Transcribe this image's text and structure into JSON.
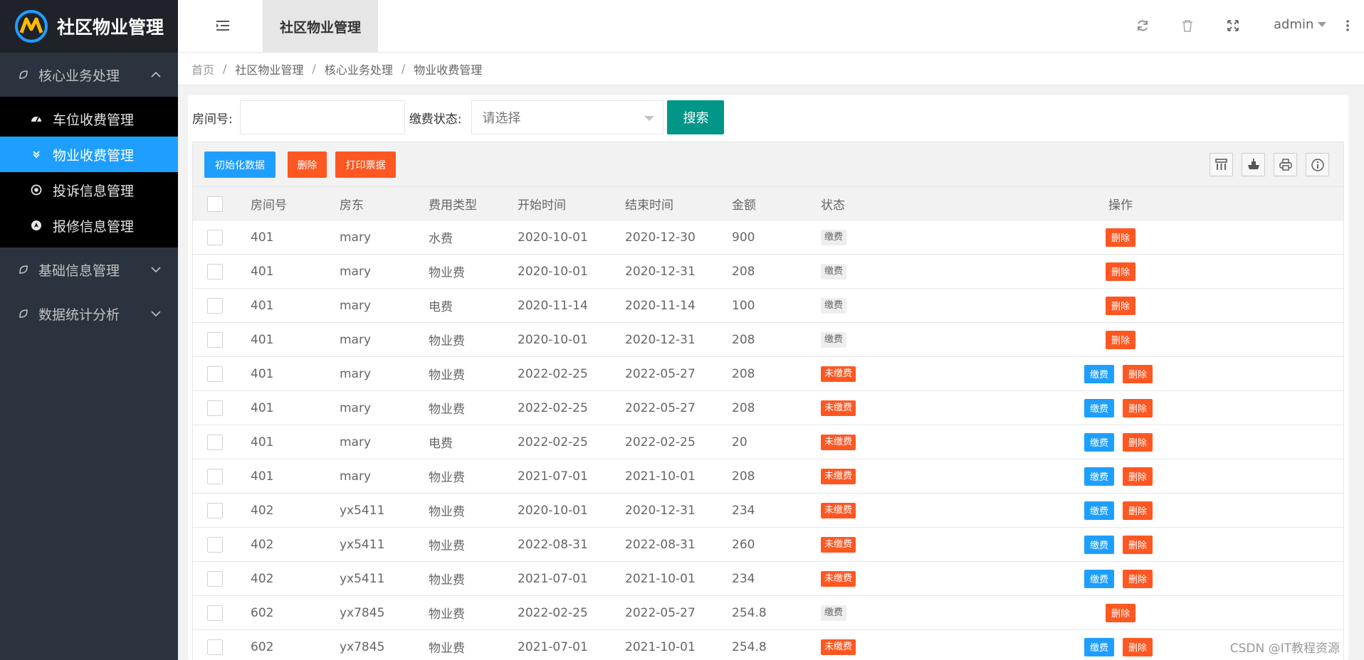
{
  "app": {
    "title": "社区物业管理"
  },
  "sidebar": {
    "groups": [
      {
        "label": "核心业务处理",
        "expanded": true
      },
      {
        "label": "基础信息管理",
        "expanded": false
      },
      {
        "label": "数据统计分析",
        "expanded": false
      }
    ],
    "items": [
      {
        "label": "车位收费管理",
        "icon": "dashboard-icon",
        "active": false
      },
      {
        "label": "物业收费管理",
        "icon": "double-chevron-icon",
        "active": true
      },
      {
        "label": "投诉信息管理",
        "icon": "target-icon",
        "active": false
      },
      {
        "label": "报修信息管理",
        "icon": "compass-icon",
        "active": false
      }
    ]
  },
  "header": {
    "tab_label": "社区物业管理",
    "username": "admin"
  },
  "breadcrumb": [
    "首页",
    "社区物业管理",
    "核心业务处理",
    "物业收费管理"
  ],
  "search": {
    "room_label": "房间号:",
    "room_value": "",
    "status_label": "缴费状态:",
    "status_placeholder": "请选择",
    "button_label": "搜索"
  },
  "toolbar": {
    "init_label": "初始化数据",
    "delete_label": "删除",
    "print_label": "打印票据"
  },
  "table": {
    "columns": [
      "房间号",
      "房东",
      "费用类型",
      "开始时间",
      "结束时间",
      "金额",
      "状态",
      "操作"
    ],
    "rows": [
      {
        "room": "401",
        "owner": "mary",
        "type": "水费",
        "start": "2020-10-01",
        "end": "2020-12-30",
        "amount": "900",
        "status": "缴费",
        "paid": true
      },
      {
        "room": "401",
        "owner": "mary",
        "type": "物业费",
        "start": "2020-10-01",
        "end": "2020-12-31",
        "amount": "208",
        "status": "缴费",
        "paid": true
      },
      {
        "room": "401",
        "owner": "mary",
        "type": "电费",
        "start": "2020-11-14",
        "end": "2020-11-14",
        "amount": "100",
        "status": "缴费",
        "paid": true
      },
      {
        "room": "401",
        "owner": "mary",
        "type": "物业费",
        "start": "2020-10-01",
        "end": "2020-12-31",
        "amount": "208",
        "status": "缴费",
        "paid": true
      },
      {
        "room": "401",
        "owner": "mary",
        "type": "物业费",
        "start": "2022-02-25",
        "end": "2022-05-27",
        "amount": "208",
        "status": "未缴费",
        "paid": false
      },
      {
        "room": "401",
        "owner": "mary",
        "type": "物业费",
        "start": "2022-02-25",
        "end": "2022-05-27",
        "amount": "208",
        "status": "未缴费",
        "paid": false
      },
      {
        "room": "401",
        "owner": "mary",
        "type": "电费",
        "start": "2022-02-25",
        "end": "2022-02-25",
        "amount": "20",
        "status": "未缴费",
        "paid": false
      },
      {
        "room": "401",
        "owner": "mary",
        "type": "物业费",
        "start": "2021-07-01",
        "end": "2021-10-01",
        "amount": "208",
        "status": "未缴费",
        "paid": false
      },
      {
        "room": "402",
        "owner": "yx5411",
        "type": "物业费",
        "start": "2020-10-01",
        "end": "2020-12-31",
        "amount": "234",
        "status": "未缴费",
        "paid": false
      },
      {
        "room": "402",
        "owner": "yx5411",
        "type": "物业费",
        "start": "2022-08-31",
        "end": "2022-08-31",
        "amount": "260",
        "status": "未缴费",
        "paid": false
      },
      {
        "room": "402",
        "owner": "yx5411",
        "type": "物业费",
        "start": "2021-07-01",
        "end": "2021-10-01",
        "amount": "234",
        "status": "未缴费",
        "paid": false
      },
      {
        "room": "602",
        "owner": "yx7845",
        "type": "物业费",
        "start": "2022-02-25",
        "end": "2022-05-27",
        "amount": "254.8",
        "status": "缴费",
        "paid": true
      },
      {
        "room": "602",
        "owner": "yx7845",
        "type": "物业费",
        "start": "2021-07-01",
        "end": "2021-10-01",
        "amount": "254.8",
        "status": "未缴费",
        "paid": false
      }
    ],
    "pay_label": "缴费",
    "delete_label": "删除"
  },
  "watermark": "CSDN @IT教程资源",
  "colors": {
    "accent": "#1e9fff",
    "danger": "#ff5722",
    "primary": "#009688",
    "sidebar": "#2b333e"
  }
}
